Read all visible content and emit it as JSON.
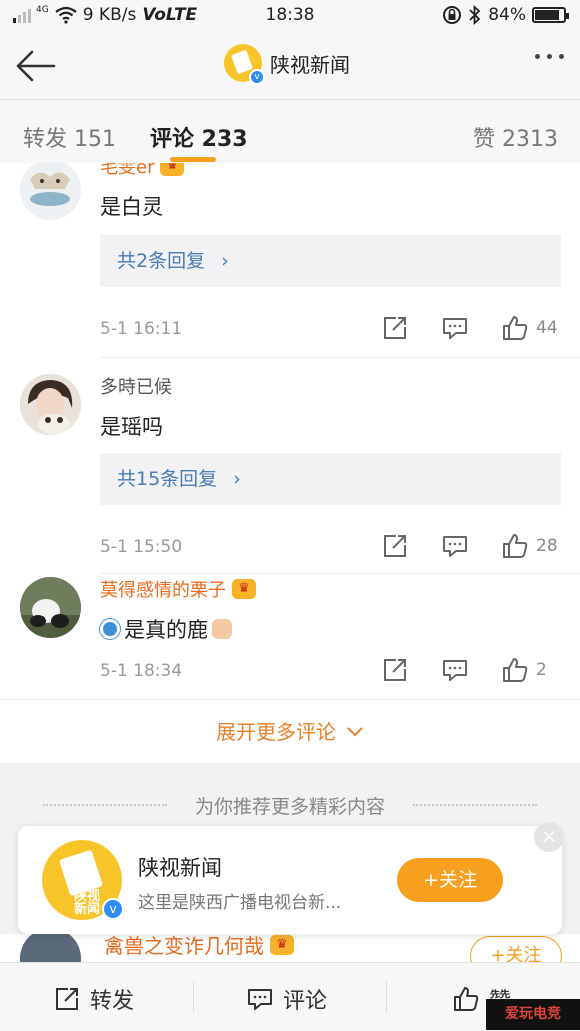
{
  "status_bar": {
    "net_type": "4G",
    "speed": "9 KB/s",
    "volte": "VoLTE",
    "time": "18:38",
    "battery": "84%",
    "battery_level": 0.84
  },
  "header": {
    "title": "陕视新闻"
  },
  "tabs": {
    "repost": "转发 151",
    "comments": "评论 233",
    "likes": "赞 2313"
  },
  "comments": [
    {
      "user": "毛雯er",
      "vip": true,
      "text": "是白灵",
      "replies": "共2条回复",
      "time": "5-1 16:11",
      "likes": "44"
    },
    {
      "user": "多時已候",
      "vip": false,
      "text": "是瑶吗",
      "replies": "共15条回复",
      "time": "5-1 15:50",
      "likes": "28"
    },
    {
      "user": "莫得感情的栗子",
      "vip": true,
      "text": "是真的鹿",
      "replies": "",
      "time": "5-1 18:34",
      "likes": "2"
    }
  ],
  "expand_more": "展开更多评论",
  "recommend_label": "为你推荐更多精彩内容",
  "rec_card": {
    "name": "陕视新闻",
    "desc": "这里是陕西广播电视台新...",
    "follow": "+关注",
    "close": "×",
    "avatar_text": "陕视新闻"
  },
  "peek_item": {
    "user": "禽兽之变诈几何哉",
    "follow": "+关注"
  },
  "bottom_bar": {
    "repost": "转发",
    "comment": "评论",
    "like": "赞"
  },
  "watermark": "爱玩电竞",
  "colors": {
    "accent": "#f7a01e",
    "vip_name": "#e86b1f",
    "reply_link": "#4a7bb5"
  }
}
